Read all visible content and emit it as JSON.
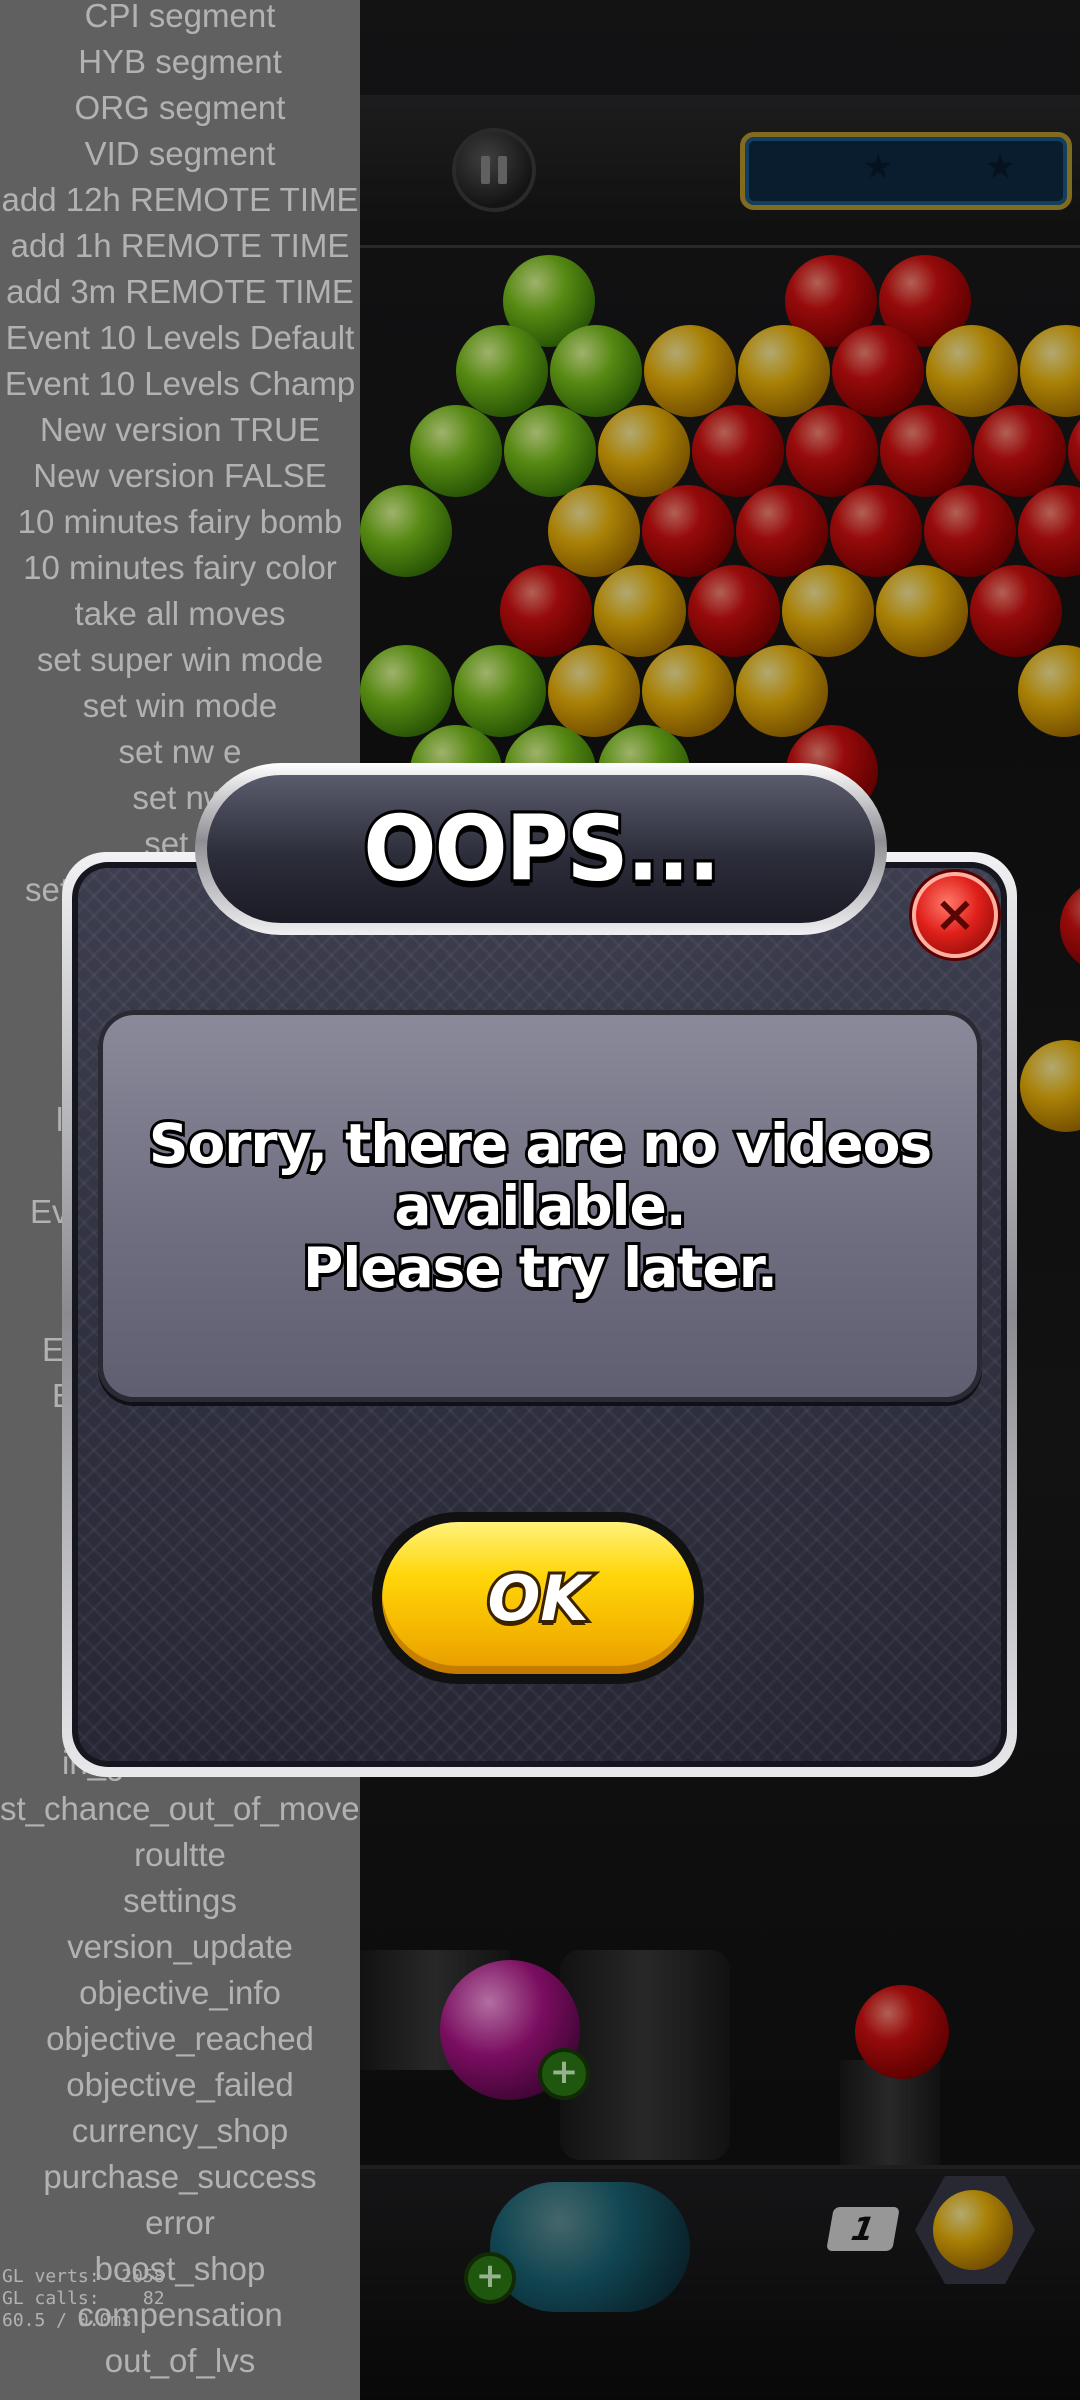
{
  "debug_menu": {
    "items": [
      "CPI segment",
      "HYB segment",
      "ORG segment",
      "VID segment",
      "add 12h REMOTE TIME",
      "add 1h REMOTE TIME",
      "add 3m REMOTE TIME",
      "Event 10 Levels Default",
      "Event 10 Levels Champ",
      "New version TRUE",
      "New version FALSE",
      "10 minutes fairy bomb",
      "10 minutes fairy color",
      "take all moves",
      "set super win mode",
      "set win mode",
      "set nw e",
      "set nw",
      "set n",
      "set",
      "l",
      "Ev",
      "E",
      "E",
      "in_g",
      "st_chance_out_of_move",
      "roultte",
      "settings",
      "version_update",
      "objective_info",
      "objective_reached",
      "objective_failed",
      "currency_shop",
      "purchase_success",
      "error",
      "boost_shop",
      "compensation",
      "out_of_lvs"
    ]
  },
  "debug_stats": {
    "line1": "GL verts:  2058",
    "line2": "GL calls:    82",
    "line3": "60.5 / 0.0ms"
  },
  "game": {
    "counter_value": "1"
  },
  "dialog": {
    "title": "OOPS...",
    "message_line1": "Sorry, there are no videos",
    "message_line2": "available.",
    "message_line3": "Please try later.",
    "ok_label": "OK",
    "close_symbol": "×"
  },
  "colors": {
    "ok_button": "#ffd60a",
    "close_button": "#e0201a",
    "dialog_body": "#2c2d3a",
    "message_panel": "#7a798b",
    "debug_panel": "#8a8a8a"
  }
}
